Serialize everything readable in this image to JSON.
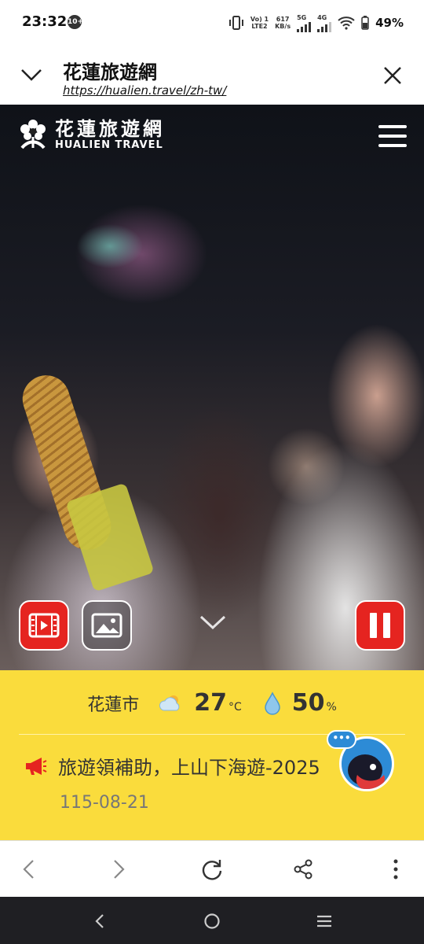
{
  "status_bar": {
    "time": "23:32",
    "notif_count": "10+",
    "volte": "Vo) 1\nLTE2",
    "speed": "617\nKB/s",
    "net1": "5G",
    "net2": "4G",
    "battery": "49%"
  },
  "browser": {
    "title": "花蓮旅遊網",
    "url": "https://hualien.travel/zh-tw/"
  },
  "hero": {
    "logo_cn": "花蓮旅遊網",
    "logo_en": "HUALIEN TRAVEL"
  },
  "weather": {
    "city": "花蓮市",
    "temperature": "27",
    "temp_unit": "°C",
    "humidity": "50",
    "humidity_unit": "%"
  },
  "news": {
    "headline": "旅遊領補助，上山下海遊-2025",
    "date": "115-08-21"
  },
  "chatbot": {
    "bubble": "•••"
  },
  "colors": {
    "accent_red": "#e52420",
    "panel_yellow": "#fadc3c",
    "chatbot_blue": "#2d8bd6"
  },
  "icons": [
    "chevron-down-icon",
    "close-icon",
    "menu-icon",
    "video-icon",
    "image-icon",
    "pause-icon",
    "cloud-sun-icon",
    "water-drop-icon",
    "megaphone-icon",
    "back-icon",
    "forward-icon",
    "reload-icon",
    "share-icon",
    "more-icon"
  ]
}
